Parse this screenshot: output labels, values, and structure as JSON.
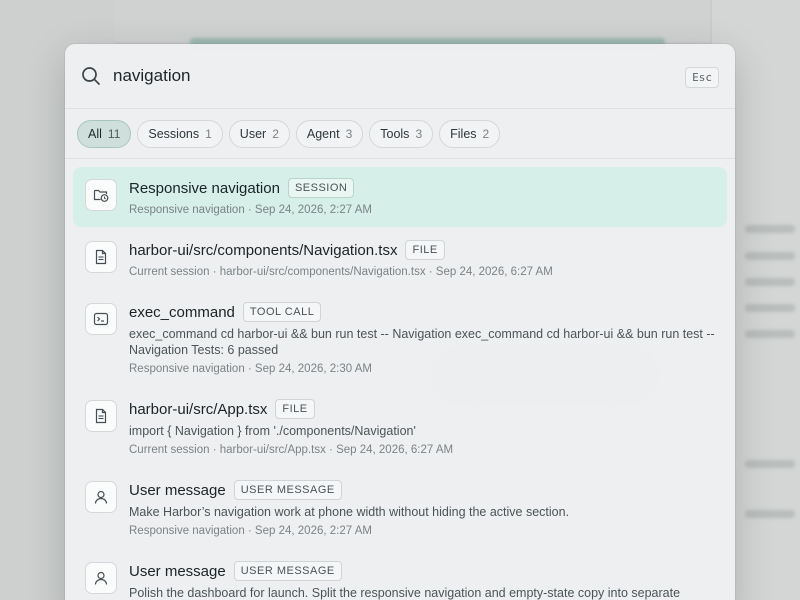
{
  "search": {
    "query": "navigation",
    "esc_label": "Esc"
  },
  "filters": [
    {
      "label": "All",
      "count": "11"
    },
    {
      "label": "Sessions",
      "count": "1"
    },
    {
      "label": "User",
      "count": "2"
    },
    {
      "label": "Agent",
      "count": "3"
    },
    {
      "label": "Tools",
      "count": "3"
    },
    {
      "label": "Files",
      "count": "2"
    }
  ],
  "results": [
    {
      "title": "Responsive navigation",
      "badge": "SESSION",
      "snippet": "",
      "meta": "Responsive navigation · Sep 24, 2026, 2:27 AM",
      "icon": "folder-clock-icon"
    },
    {
      "title": "harbor-ui/src/components/Navigation.tsx",
      "badge": "FILE",
      "snippet": "",
      "meta": "Current session · harbor-ui/src/components/Navigation.tsx · Sep 24, 2026, 6:27 AM",
      "icon": "file-icon"
    },
    {
      "title": "exec_command",
      "badge": "TOOL CALL",
      "snippet": "exec_command cd harbor-ui && bun run test -- Navigation exec_command cd harbor-ui && bun run test -- Navigation Tests: 6 passed",
      "meta": "Responsive navigation · Sep 24, 2026, 2:30 AM",
      "icon": "terminal-icon"
    },
    {
      "title": "harbor-ui/src/App.tsx",
      "badge": "FILE",
      "snippet": "import { Navigation } from './components/Navigation'",
      "meta": "Current session · harbor-ui/src/App.tsx · Sep 24, 2026, 6:27 AM",
      "icon": "file-icon"
    },
    {
      "title": "User message",
      "badge": "USER MESSAGE",
      "snippet": "Make Harbor’s navigation work at phone width without hiding the active section.",
      "meta": "Responsive navigation · Sep 24, 2026, 2:27 AM",
      "icon": "user-icon"
    },
    {
      "title": "User message",
      "badge": "USER MESSAGE",
      "snippet": "Polish the dashboard for launch. Split the responsive navigation and empty-state copy into separate tasks, then bring the work together.",
      "meta": "",
      "icon": "user-icon"
    }
  ]
}
